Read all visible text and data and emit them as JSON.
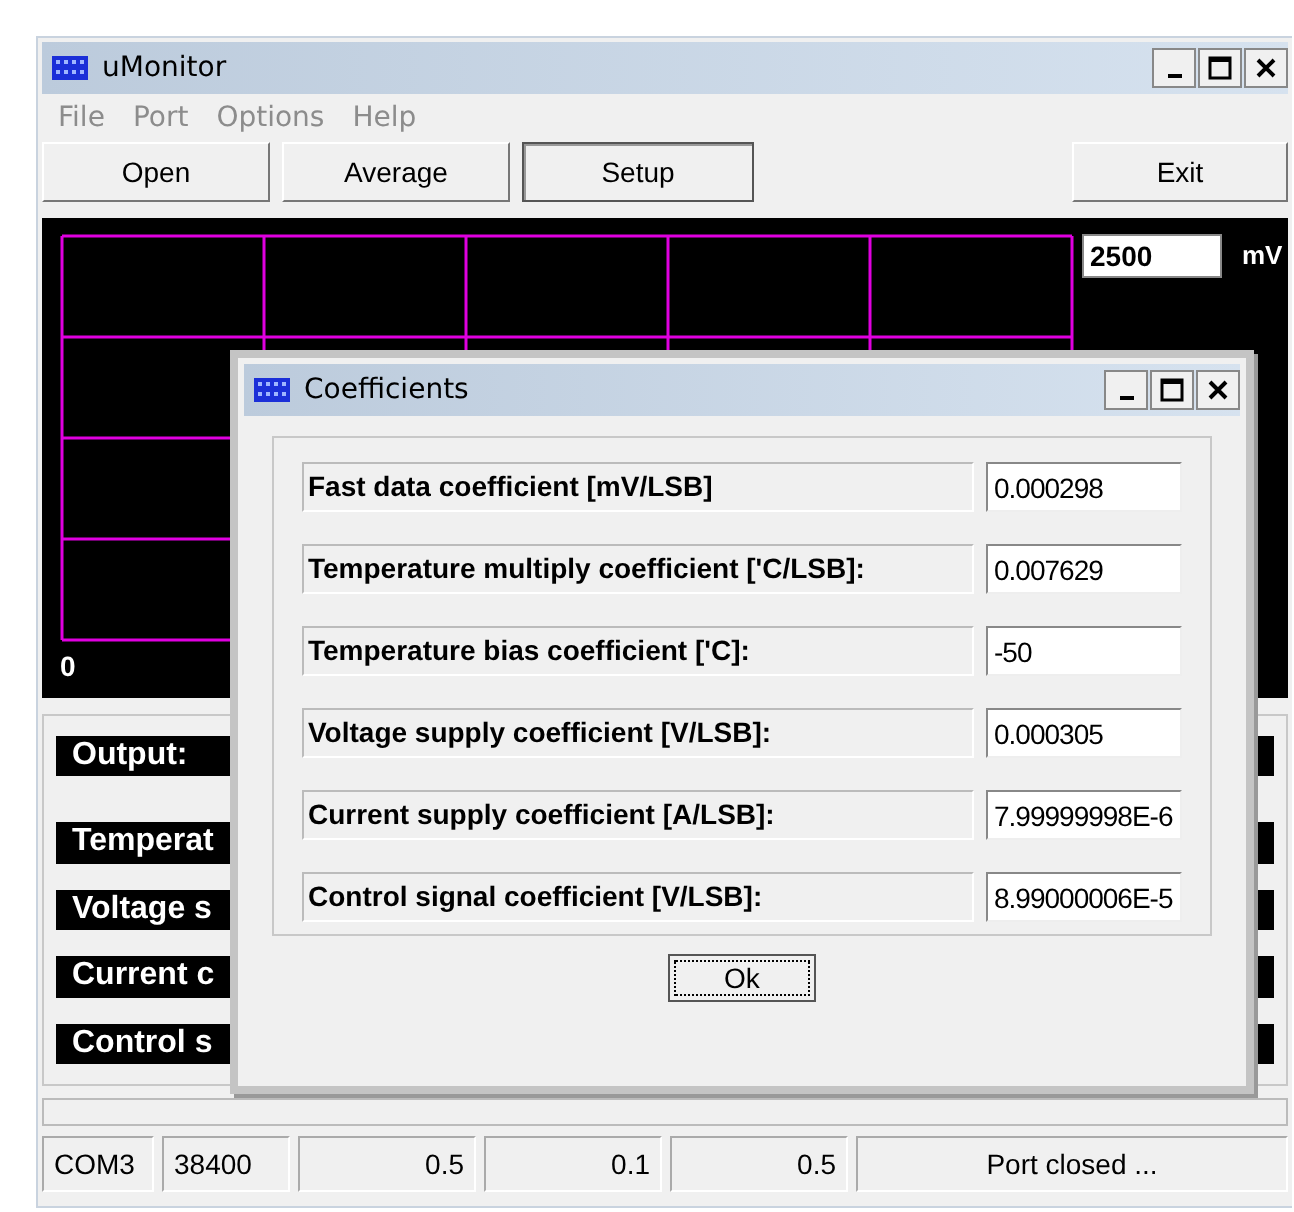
{
  "window": {
    "title": "uMonitor"
  },
  "menu": [
    "File",
    "Port",
    "Options",
    "Help"
  ],
  "toolbar": [
    {
      "label": "Open",
      "selected": false
    },
    {
      "label": "Average",
      "selected": false
    },
    {
      "label": "Setup",
      "selected": true
    }
  ],
  "exit_button": "Exit",
  "plot": {
    "scale_value": "2500",
    "unit": "mV",
    "origin_label": "0"
  },
  "readouts": [
    {
      "label": "Output:"
    },
    {
      "label": "Temperat"
    },
    {
      "label": "Voltage s"
    },
    {
      "label": "Current c"
    },
    {
      "label": "Control s"
    }
  ],
  "status_bar": [
    "COM3",
    "38400",
    "0.5",
    "0.1",
    "0.5",
    "Port closed ..."
  ],
  "dialog": {
    "title": "Coefficients",
    "fields": [
      {
        "label": "Fast data coefficient [mV/LSB]",
        "value": "0.000298"
      },
      {
        "label": "Temperature multiply coefficient ['C/LSB]:",
        "value": "0.007629"
      },
      {
        "label": "Temperature bias coefficient ['C]:",
        "value": "-50"
      },
      {
        "label": "Voltage supply coefficient [V/LSB]:",
        "value": "0.000305"
      },
      {
        "label": "Current supply coefficient [A/LSB]:",
        "value": "7.99999998E-6"
      },
      {
        "label": "Control signal coefficient [V/LSB]:",
        "value": "8.99000006E-5"
      }
    ],
    "ok_button": "Ok"
  }
}
